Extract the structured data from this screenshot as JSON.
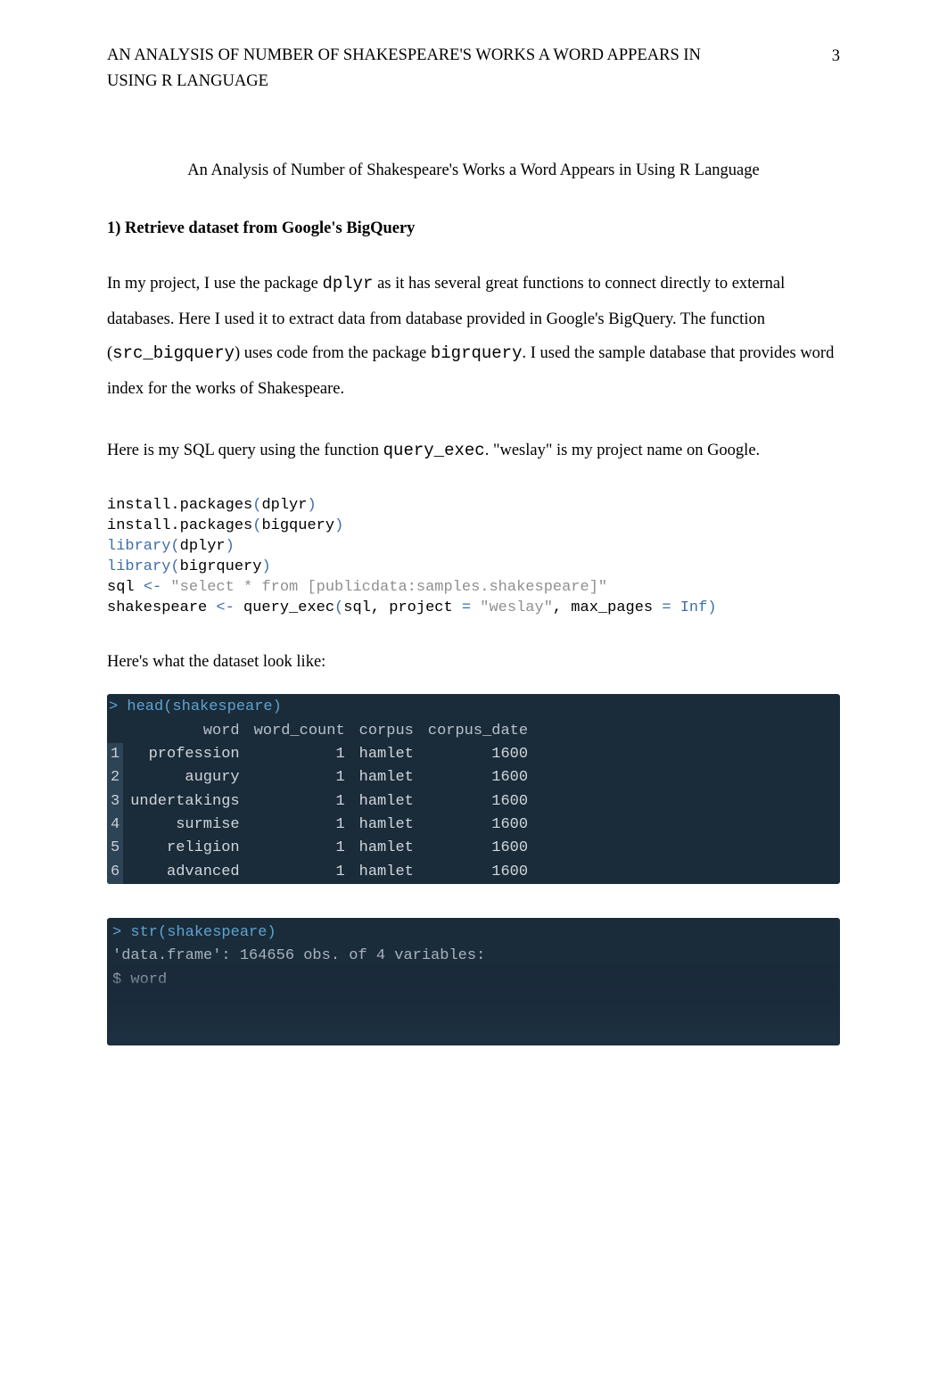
{
  "header": {
    "running_title": "AN ANALYSIS OF NUMBER OF SHAKESPEARE'S WORKS A WORD APPEARS IN USING R LANGUAGE",
    "page_number": "3"
  },
  "title_center": "An Analysis of Number of Shakespeare's Works a Word Appears in Using R Language",
  "section1_heading": "1) Retrieve dataset from Google's BigQuery",
  "para1": {
    "t1": "In my project, I use the package ",
    "code1": "dplyr",
    "t2": " as it has several great functions to connect directly to external databases. Here I used it to extract data from database provided in Google's BigQuery. The function (",
    "code2": "src_bigquery",
    "t3": ") uses code from the package ",
    "code3": "bigrquery",
    "t4": ". I used the sample database that provides word index for the works of Shakespeare."
  },
  "para2": {
    "t1": "Here is my SQL query using the function ",
    "code1": "query_exec",
    "t2": ". \"weslay\" is my project name on Google."
  },
  "r_code": {
    "l1a": "install.packages",
    "l1b": "(",
    "l1c": "dplyr",
    "l1d": ")",
    "l2a": "install.packages",
    "l2b": "(",
    "l2c": "bigquery",
    "l2d": ")",
    "l3a": "library",
    "l3b": "(",
    "l3c": "dplyr",
    "l3d": ")",
    "l4a": "library",
    "l4b": "(",
    "l4c": "bigrquery",
    "l4d": ")",
    "l5a": "sql ",
    "l5op": "<-",
    "l5b": " ",
    "l5str": "\"select * from [publicdata:samples.shakespeare]\"",
    "l6a": "shakespeare ",
    "l6op": "<-",
    "l6b": " query_exec",
    "l6p1": "(",
    "l6c": "sql, project ",
    "l6eq1": "=",
    "l6d": " ",
    "l6str": "\"weslay\"",
    "l6e": ", max_pages ",
    "l6eq2": "=",
    "l6f": " ",
    "l6inf": "Inf",
    "l6p2": ")"
  },
  "para3": "Here's what the dataset look like:",
  "console1": {
    "prompt": "> head(shakespeare)",
    "cols": [
      "",
      "word",
      "word_count",
      "corpus",
      "corpus_date"
    ],
    "rows": [
      {
        "n": "1",
        "word": "profession",
        "wc": "1",
        "corpus": "hamlet",
        "date": "1600"
      },
      {
        "n": "2",
        "word": "augury",
        "wc": "1",
        "corpus": "hamlet",
        "date": "1600"
      },
      {
        "n": "3",
        "word": "undertakings",
        "wc": "1",
        "corpus": "hamlet",
        "date": "1600"
      },
      {
        "n": "4",
        "word": "surmise",
        "wc": "1",
        "corpus": "hamlet",
        "date": "1600"
      },
      {
        "n": "5",
        "word": "religion",
        "wc": "1",
        "corpus": "hamlet",
        "date": "1600"
      },
      {
        "n": "6",
        "word": "advanced",
        "wc": "1",
        "corpus": "hamlet",
        "date": "1600"
      }
    ]
  },
  "console2": {
    "line1": "> str(shakespeare)",
    "line2": "'data.frame':   164656 obs. of  4 variables:",
    "line3": " $ word"
  }
}
